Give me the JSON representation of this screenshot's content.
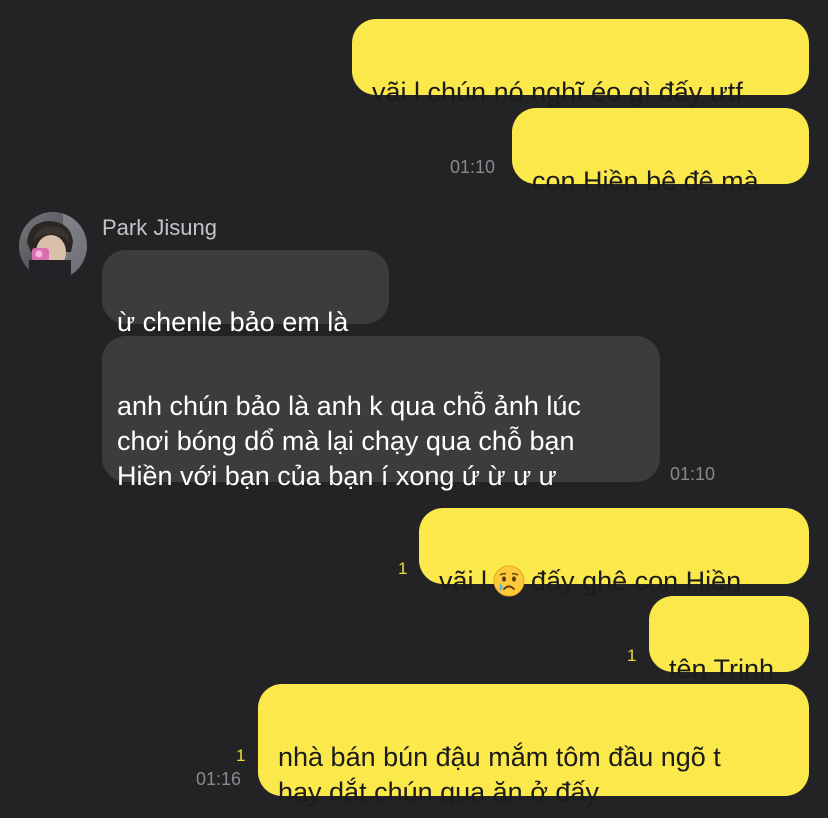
{
  "chat": {
    "sender_name": "Park Jisung",
    "messages": [
      {
        "from": "me",
        "text": "vãi l chún nó nghĩ éo gì đấy ưtf"
      },
      {
        "from": "me",
        "text": "con Hiền bê đê mà",
        "time": "01:10"
      },
      {
        "from": "them",
        "text": "ừ chenle bảo em là"
      },
      {
        "from": "them",
        "text": "anh chún bảo là anh k qua chỗ ảnh lúc\nchơi bóng dổ mà lại chạy qua chỗ bạn\nHiền với bạn của bạn í xong ứ ừ ư ư",
        "time": "01:10"
      },
      {
        "from": "me",
        "text_before": "vãi l",
        "emoji": "crying-face",
        "text_after": "đấy ghệ con Hiền",
        "unread": "1"
      },
      {
        "from": "me",
        "text": "tên Trinh",
        "unread": "1"
      },
      {
        "from": "me",
        "text": "nhà bán bún đậu mắm tôm đầu ngõ t\nhay dắt chún qua ăn ở đấy",
        "unread": "1",
        "time": "01:16"
      }
    ]
  },
  "colors": {
    "background": "#232325",
    "outgoing_bubble": "#FBE84B",
    "incoming_bubble": "#3C3C3E",
    "unread_count": "#F2DA35",
    "timestamp": "#8A8A8E"
  }
}
